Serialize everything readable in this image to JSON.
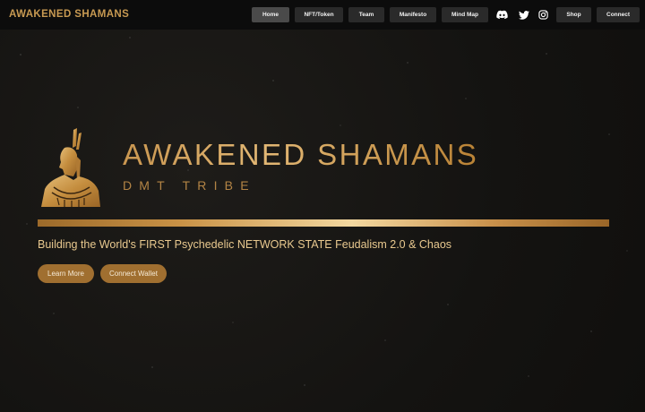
{
  "nav": {
    "brand": "AWAKENED SHAMANS",
    "links": [
      {
        "label": "Home",
        "active": true
      },
      {
        "label": "NFT/Token"
      },
      {
        "label": "Team"
      },
      {
        "label": "Manifesto"
      },
      {
        "label": "Mind Map"
      }
    ],
    "social_icons": [
      "discord-icon",
      "twitter-icon",
      "instagram-icon"
    ],
    "shop_label": "Shop",
    "connect_label": "Connect"
  },
  "hero": {
    "title": "AWAKENED SHAMANS",
    "subtitle": "DMT TRIBE",
    "tagline": "Building the World's FIRST Psychedelic NETWORK STATE Feudalism 2.0 & Chaos",
    "learn_more_label": "Learn More",
    "connect_wallet_label": "Connect Wallet"
  },
  "colors": {
    "gold": "#c48d3e",
    "button": "#a06f30",
    "nav_bg": "#0c0c0c",
    "page_bg": "#151412"
  }
}
